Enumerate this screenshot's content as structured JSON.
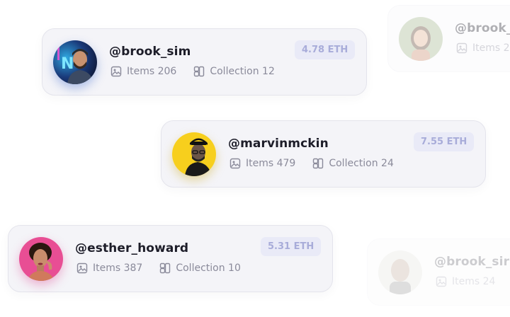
{
  "cards": [
    {
      "handle": "@brook_sim",
      "items_label": "Items 206",
      "collection_label": "Collection 12",
      "price": "4.78 ETH",
      "avatar_bg": "#1f2a4a"
    },
    {
      "handle": "@marvinmckin",
      "items_label": "Items 479",
      "collection_label": "Collection 24",
      "price": "7.55 ETH",
      "avatar_bg": "#f7cf1d"
    },
    {
      "handle": "@esther_howard",
      "items_label": "Items 387",
      "collection_label": "Collection 10",
      "price": "5.31 ETH",
      "avatar_bg": "#e84e94"
    }
  ],
  "faded_cards": [
    {
      "handle": "@brook_sim",
      "items_label": "Items 2"
    },
    {
      "handle": "@brook_sir",
      "items_label": "Items 24"
    }
  ],
  "icons": {
    "items": "image-icon",
    "collection": "collection-icon"
  },
  "colors": {
    "card_bg": "#f4f4f8",
    "price_bg": "#e9eaf7",
    "price_text": "#a8acd9",
    "handle_text": "#1d1d29",
    "meta_text": "#8a8a9a"
  }
}
